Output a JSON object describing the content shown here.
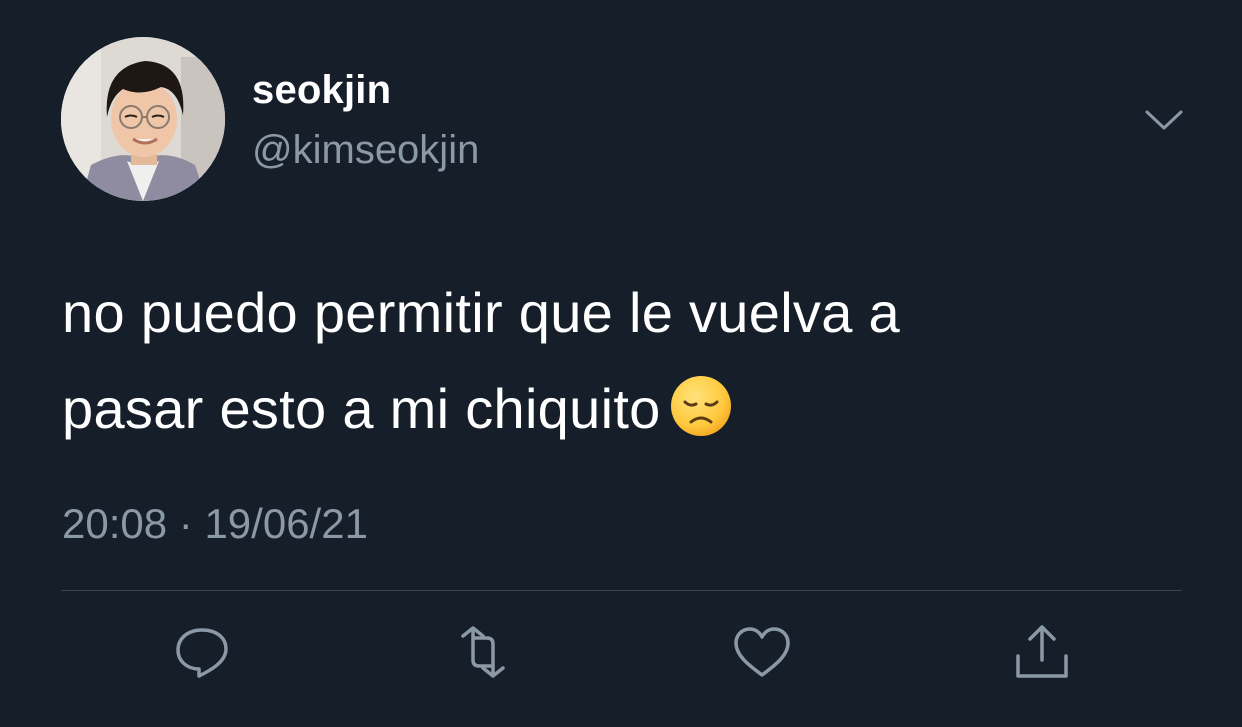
{
  "user": {
    "display_name": "seokjin",
    "handle": "@kimseokjin",
    "avatar_icon": "profile-photo"
  },
  "tweet": {
    "text_line1": "no puedo permitir que le vuelva a",
    "text_line2": "pasar esto a mi chiquito",
    "emoji": "disappointed-face",
    "time": "20:08",
    "separator": "·",
    "date": "19/06/21"
  },
  "actions": [
    {
      "icon": "reply-icon"
    },
    {
      "icon": "retweet-icon"
    },
    {
      "icon": "like-icon"
    },
    {
      "icon": "share-icon"
    }
  ],
  "colors": {
    "background": "#161e2a",
    "text_primary": "#ffffff",
    "text_secondary": "#8b98a6",
    "divider": "#38444d"
  }
}
